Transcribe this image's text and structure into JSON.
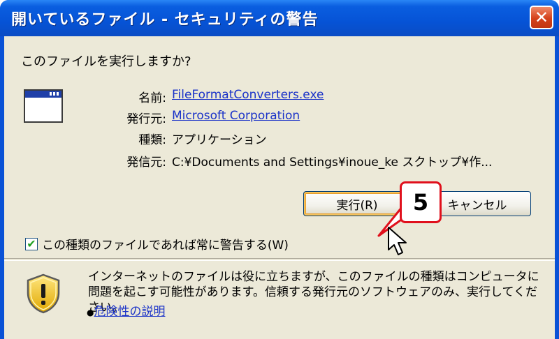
{
  "window": {
    "title": "開いているファイル - セキュリティの警告",
    "close_glyph": "✕"
  },
  "dialog": {
    "question": "このファイルを実行しますか?",
    "icon": "application-window-icon",
    "fields": [
      {
        "label": "名前:",
        "value": "FileFormatConverters.exe",
        "is_link": true
      },
      {
        "label": "発行元:",
        "value": "Microsoft Corporation",
        "is_link": true
      },
      {
        "label": "種類:",
        "value": "アプリケーション",
        "is_link": false
      },
      {
        "label": "発信元:",
        "value": "C:¥Documents and Settings¥inoue_ke   スクトップ¥作...",
        "is_link": false
      }
    ],
    "buttons": {
      "run": "実行(R)",
      "cancel": "キャンセル"
    },
    "checkbox": {
      "label": "この種類のファイルであれば常に警告する(W)",
      "checked": true,
      "check_glyph": "✔"
    },
    "warning": {
      "text": "インターネットのファイルは役に立ちますが、このファイルの種類はコンピュータに問題を起こす可能性があります。信頼する発行元のソフトウェアのみ、実行してください。",
      "link_prefix": "●",
      "link": "危険性の説明",
      "icon": "security-shield-icon"
    }
  },
  "annotation": {
    "step_number": "5"
  },
  "colors": {
    "titlebar": "#0653d6",
    "dialog_bg": "#ece9d8",
    "link": "#1a32c8",
    "callout_border": "#e0101c"
  }
}
